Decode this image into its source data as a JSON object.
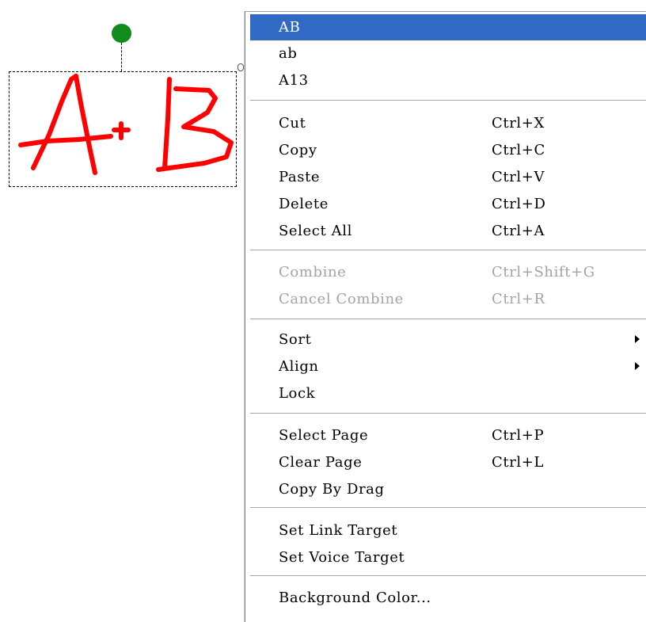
{
  "context_menu": {
    "recognition_items": [
      {
        "label": "AB",
        "highlighted": true
      },
      {
        "label": "ab"
      },
      {
        "label": "A13"
      }
    ],
    "edit_items": [
      {
        "label": "Cut",
        "shortcut": "Ctrl+X"
      },
      {
        "label": "Copy",
        "shortcut": "Ctrl+C"
      },
      {
        "label": "Paste",
        "shortcut": "Ctrl+V"
      },
      {
        "label": "Delete",
        "shortcut": "Ctrl+D"
      },
      {
        "label": "Select All",
        "shortcut": "Ctrl+A"
      }
    ],
    "combine_items": [
      {
        "label": "Combine",
        "shortcut": "Ctrl+Shift+G",
        "disabled": true
      },
      {
        "label": "Cancel Combine",
        "shortcut": "Ctrl+R",
        "disabled": true
      }
    ],
    "arrange_items": [
      {
        "label": "Sort",
        "submenu": true
      },
      {
        "label": "Align",
        "submenu": true
      },
      {
        "label": "Lock"
      }
    ],
    "page_items": [
      {
        "label": "Select Page",
        "shortcut": "Ctrl+P"
      },
      {
        "label": "Clear Page",
        "shortcut": "Ctrl+L"
      },
      {
        "label": "Copy By Drag"
      }
    ],
    "target_items": [
      {
        "label": "Set Link Target"
      },
      {
        "label": "Set Voice Target"
      }
    ],
    "background_items": [
      {
        "label": "Background Color..."
      }
    ]
  },
  "colors": {
    "ink": "#ff0000",
    "highlight": "#316ac5",
    "rotate_handle": "#118a1e",
    "disabled_text": "#a3a3a3"
  },
  "icons": [
    "submenu-arrow-icon",
    "rotate-handle-icon"
  ]
}
